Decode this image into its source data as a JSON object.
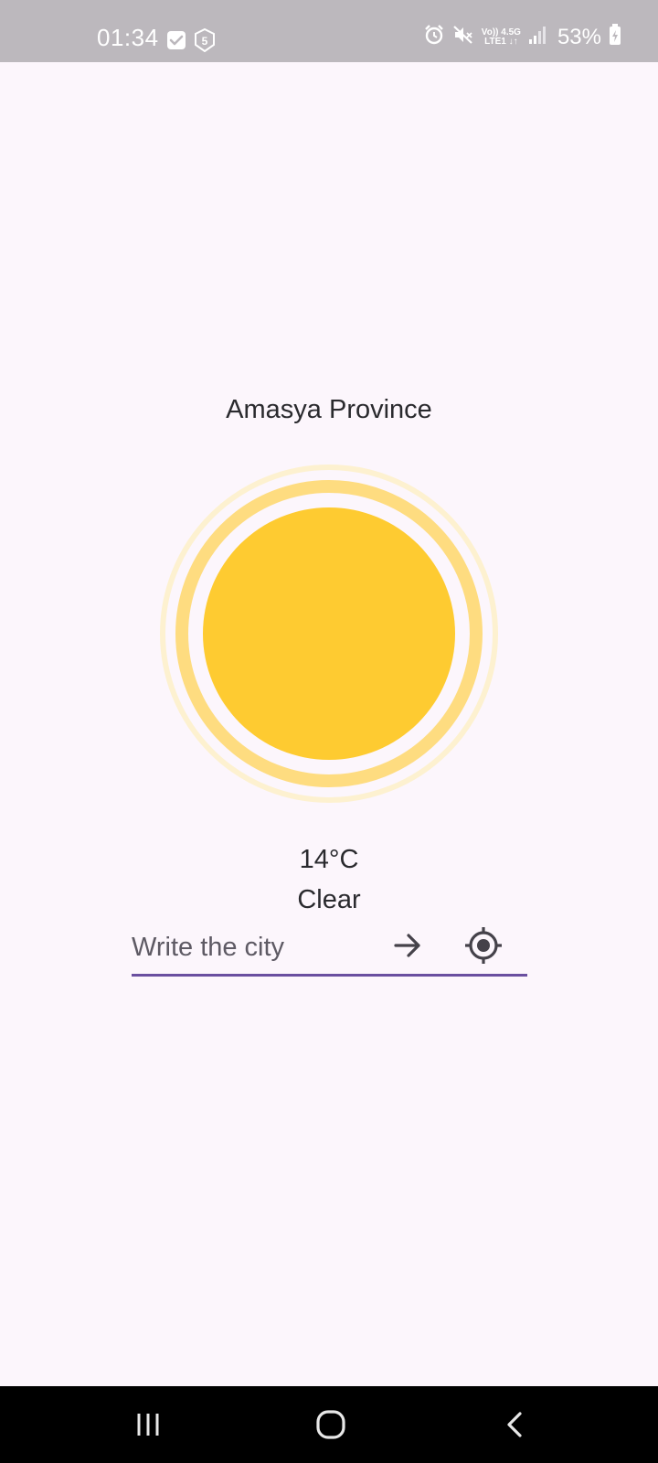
{
  "status_bar": {
    "time": "01:34",
    "network_top": "Vo)) 4.5G",
    "network_bottom": "LTE1 ↓↑",
    "battery": "53%",
    "icons": [
      "checkbox-icon",
      "shield-5-icon",
      "alarm-icon",
      "mute-icon",
      "signal-icon",
      "battery-charging-icon"
    ]
  },
  "weather": {
    "city": "Amasya Province",
    "temperature": "14°C",
    "condition": "Clear",
    "icon": "sun-icon",
    "sun_colors": {
      "core": "#fecb31",
      "middle_ring": "#fedc80",
      "outer_ring": "#fdf1d0"
    }
  },
  "search": {
    "placeholder": "Write the city",
    "value": "",
    "submit_icon": "arrow-right-icon",
    "location_icon": "my-location-icon",
    "underline_color": "#6a4fa0"
  },
  "nav": {
    "recents_icon": "recents-icon",
    "home_icon": "home-icon",
    "back_icon": "back-icon"
  }
}
